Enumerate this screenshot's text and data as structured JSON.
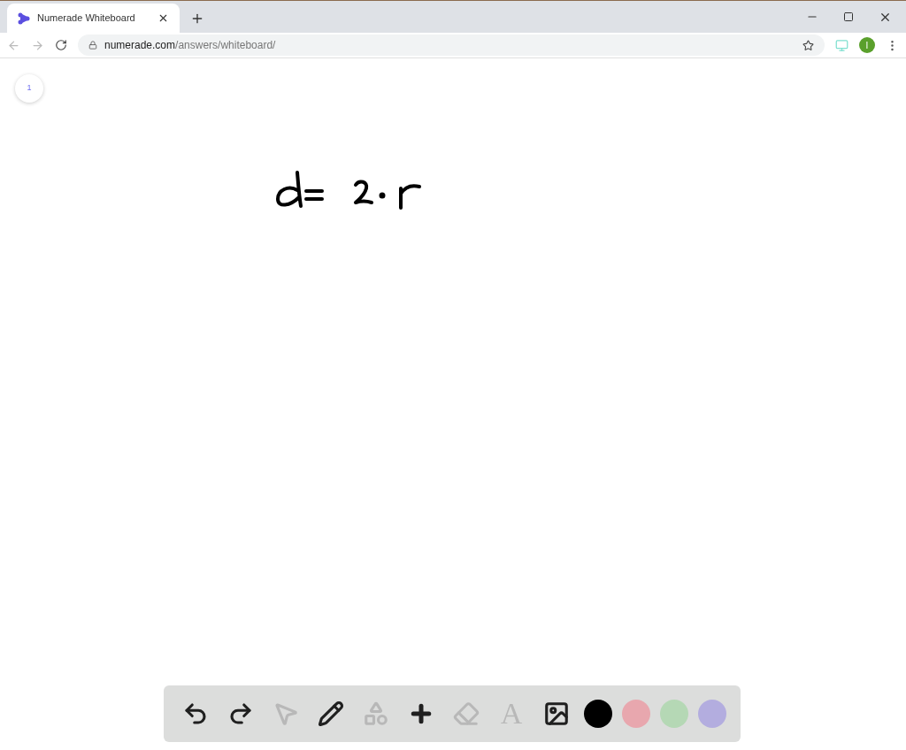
{
  "browser": {
    "tab": {
      "title": "Numerade Whiteboard",
      "selected": true
    },
    "url": {
      "domain": "numerade.com",
      "path": "/answers/whiteboard/"
    },
    "profile_initial": "I"
  },
  "page_indicator": "1",
  "toolbar": {
    "tools": [
      {
        "kind": "undo",
        "disabled": false
      },
      {
        "kind": "redo",
        "disabled": false
      },
      {
        "kind": "select",
        "disabled": true
      },
      {
        "kind": "pencil",
        "disabled": false
      },
      {
        "kind": "shapes",
        "disabled": true
      },
      {
        "kind": "add",
        "disabled": false
      },
      {
        "kind": "eraser",
        "disabled": true
      },
      {
        "kind": "text",
        "disabled": true,
        "label": "A"
      },
      {
        "kind": "image",
        "disabled": false
      }
    ],
    "colors": [
      {
        "color": "#000000"
      },
      {
        "color": "#e8a7ae"
      },
      {
        "color": "#b5d8b5"
      },
      {
        "color": "#b3addf"
      }
    ]
  }
}
